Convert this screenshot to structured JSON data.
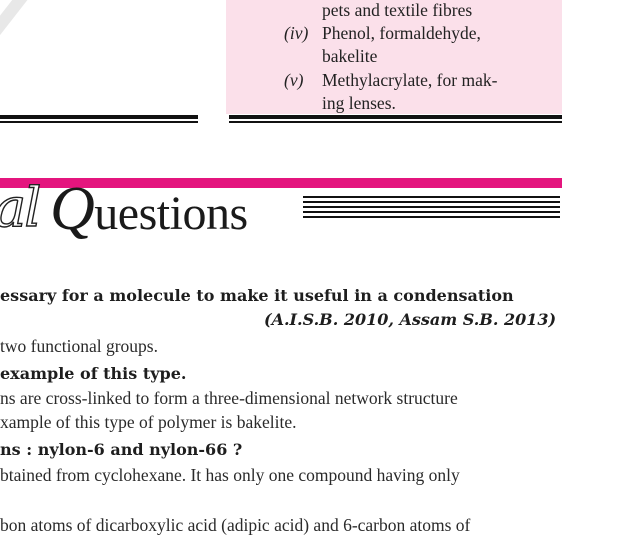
{
  "list": [
    {
      "num": "",
      "line1": "pets and textile fibres",
      "line2": ""
    },
    {
      "num": "(iv)",
      "line1": "Phenol, formaldehyde,",
      "line2": "bakelite"
    },
    {
      "num": "(v)",
      "line1": "Methylacrylate, for mak-",
      "line2": "ing lenses."
    }
  ],
  "banner": {
    "script_text": "al",
    "title_first": "Q",
    "title_rest": "uestions"
  },
  "content": {
    "q1_line1": "essary for a molecule to make it useful in a condensation",
    "q1_citation": "(A.I.S.B. 2010, Assam S.B. 2013)",
    "a1": "two functional groups.",
    "q2": "example of this type.",
    "a2_line1": "ns are cross-linked to form a three-dimensional network structure",
    "a2_line2": "xample of this type of polymer is bakelite.",
    "q3": "ns : nylon-6 and nylon-66 ?",
    "a3_line1": "btained from cyclohexane. It has only one compound having only",
    "a4_line1": "bon atoms of dicarboxylic acid (adipic acid) and 6-carbon atoms of"
  },
  "colors": {
    "pink_box": "#fbe0ea",
    "magenta_bar": "#e4157e",
    "rules": "#111111"
  }
}
